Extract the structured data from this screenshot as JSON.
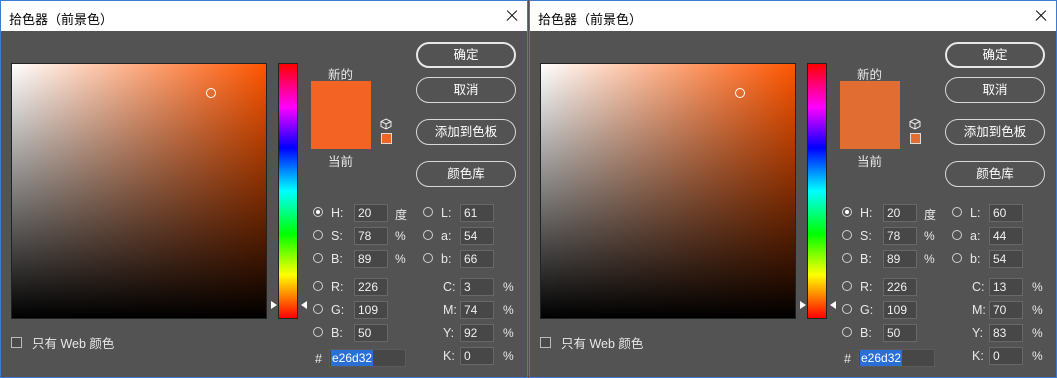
{
  "dialogs": [
    {
      "title": "拾色器（前景色）",
      "new_label": "新的",
      "current_label": "当前",
      "new_color": "#f26324",
      "current_color": "#f26324",
      "buttons": {
        "ok": "确定",
        "cancel": "取消",
        "add_swatch": "添加到色板",
        "color_libraries": "颜色库"
      },
      "only_web_colors": "只有 Web 颜色",
      "hsb": {
        "h": "20",
        "s": "78",
        "b": "89",
        "h_unit": "度",
        "s_unit": "%",
        "b_unit": "%"
      },
      "lab": {
        "l": "61",
        "a": "54",
        "b": "66"
      },
      "rgb": {
        "r": "226",
        "g": "109",
        "b": "50"
      },
      "cmyk": {
        "c": "3",
        "m": "74",
        "y": "92",
        "k": "0",
        "unit": "%"
      },
      "hex": "e26d32",
      "selected_radio": "H",
      "field_hue_color": "#ff5500"
    },
    {
      "title": "拾色器（前景色）",
      "new_label": "新的",
      "current_label": "当前",
      "new_color": "#e26d32",
      "current_color": "#e26d32",
      "buttons": {
        "ok": "确定",
        "cancel": "取消",
        "add_swatch": "添加到色板",
        "color_libraries": "颜色库"
      },
      "only_web_colors": "只有 Web 颜色",
      "hsb": {
        "h": "20",
        "s": "78",
        "b": "89",
        "h_unit": "度",
        "s_unit": "%",
        "b_unit": "%"
      },
      "lab": {
        "l": "60",
        "a": "44",
        "b": "54"
      },
      "rgb": {
        "r": "226",
        "g": "109",
        "b": "50"
      },
      "cmyk": {
        "c": "13",
        "m": "70",
        "y": "83",
        "k": "0",
        "unit": "%"
      },
      "hex": "e26d32",
      "selected_radio": "H",
      "field_hue_color": "#ff5500"
    }
  ],
  "labels": {
    "H": "H:",
    "S": "S:",
    "B": "B:",
    "L": "L:",
    "a": "a:",
    "b": "b:",
    "R": "R:",
    "G": "G:",
    "Bb": "B:",
    "C": "C:",
    "M": "M:",
    "Y": "Y:",
    "K": "K:",
    "hash": "#"
  },
  "icons": {
    "gamut": "cube-icon",
    "close": "close-icon"
  }
}
